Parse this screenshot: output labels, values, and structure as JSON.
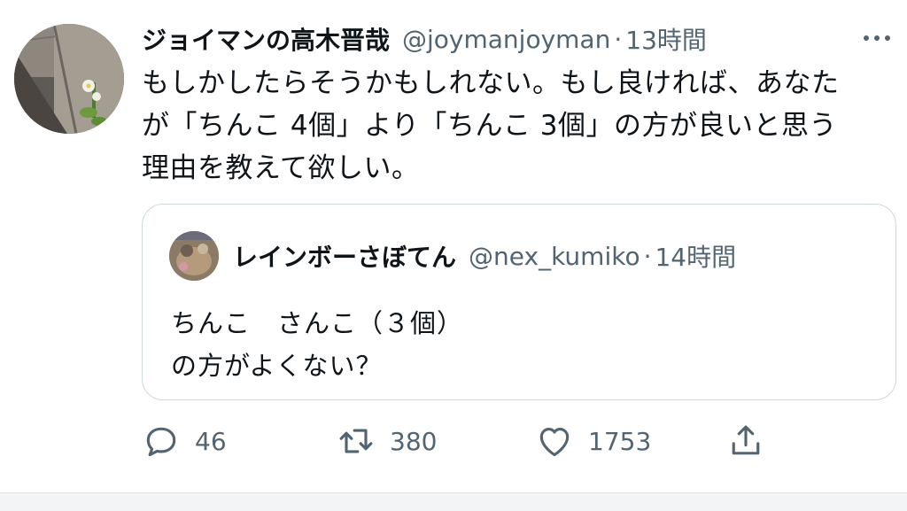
{
  "tweet": {
    "author_name": "ジョイマンの高木晋哉",
    "handle": "@joymanjoyman",
    "separator": "·",
    "time": "13時間",
    "text": "もしかしたらそうかもしれない。もし良ければ、あなた\nが「ちんこ 4個」より「ちんこ 3個」の方が良いと思う\n理由を教えて欲しい。"
  },
  "quote": {
    "author_name": "レインボーさぼてん",
    "handle": "@nex_kumiko",
    "separator": "·",
    "time": "14時間",
    "text": "ちんこ　さんこ（３個）\nの方がよくない？"
  },
  "actions": {
    "reply_count": "46",
    "retweet_count": "380",
    "like_count": "1753"
  },
  "icons": {
    "reply": "speech-bubble-icon",
    "retweet": "retweet-arrows-icon",
    "like": "heart-outline-icon",
    "share": "share-upload-icon",
    "more": "more-dots-icon"
  },
  "colors": {
    "text": "#0f1419",
    "secondary": "#536471",
    "border": "#cfd9de"
  }
}
